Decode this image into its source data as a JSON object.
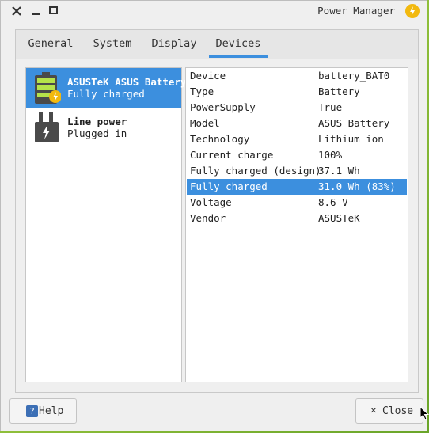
{
  "window": {
    "title": "Power Manager"
  },
  "tabs": [
    {
      "label": "General"
    },
    {
      "label": "System"
    },
    {
      "label": "Display"
    },
    {
      "label": "Devices",
      "active": true
    }
  ],
  "devices": [
    {
      "name": "ASUSTeK ASUS Battery",
      "status": "Fully charged",
      "icon": "battery-icon",
      "selected": true
    },
    {
      "name": "Line power",
      "status": "Plugged in",
      "icon": "plug-icon",
      "selected": false
    }
  ],
  "properties": [
    {
      "key": "Device",
      "value": "battery_BAT0"
    },
    {
      "key": "Type",
      "value": "Battery"
    },
    {
      "key": "PowerSupply",
      "value": "True"
    },
    {
      "key": "Model",
      "value": "ASUS Battery"
    },
    {
      "key": "Technology",
      "value": "Lithium ion"
    },
    {
      "key": "Current charge",
      "value": "100%"
    },
    {
      "key": "Fully charged (design)",
      "value": "37.1 Wh"
    },
    {
      "key": "Fully charged",
      "value": "31.0 Wh (83%)",
      "selected": true
    },
    {
      "key": "Voltage",
      "value": "8.6 V"
    },
    {
      "key": "Vendor",
      "value": "ASUSTeK"
    }
  ],
  "buttons": {
    "help": "Help",
    "close": "Close"
  },
  "colors": {
    "accent": "#3c8fde",
    "battery_green": "#b5e24a",
    "bolt": "#f2b90f"
  }
}
